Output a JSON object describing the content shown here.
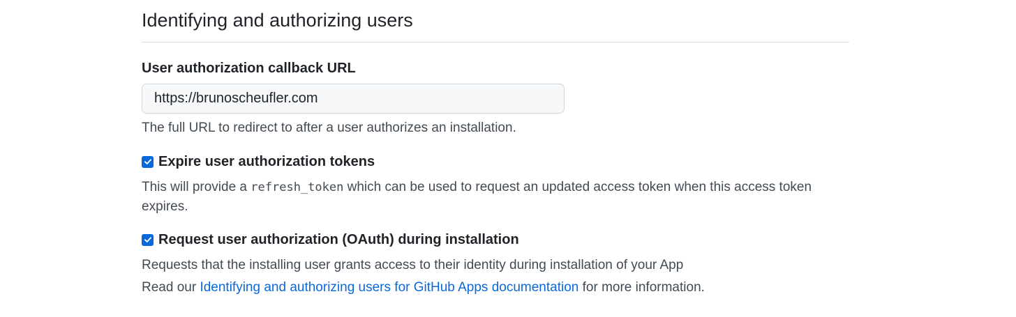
{
  "section": {
    "title": "Identifying and authorizing users"
  },
  "callback_url": {
    "label": "User authorization callback URL",
    "value": "https://brunoscheufler.com",
    "note": "The full URL to redirect to after a user authorizes an installation."
  },
  "expire_tokens": {
    "checked": true,
    "label": "Expire user authorization tokens",
    "note_before": "This will provide a ",
    "note_code": "refresh_token",
    "note_after": " which can be used to request an updated access token when this access token expires."
  },
  "request_oauth": {
    "checked": true,
    "label": "Request user authorization (OAuth) during installation",
    "note": "Requests that the installing user grants access to their identity during installation of your App"
  },
  "docs": {
    "prefix": "Read our ",
    "link_text": "Identifying and authorizing users for GitHub Apps documentation",
    "suffix": " for more information."
  },
  "colors": {
    "accent": "#0969da",
    "text": "#1f2328",
    "muted": "#424a53",
    "border": "#d0d7de",
    "input_bg": "#f6f8fa"
  }
}
